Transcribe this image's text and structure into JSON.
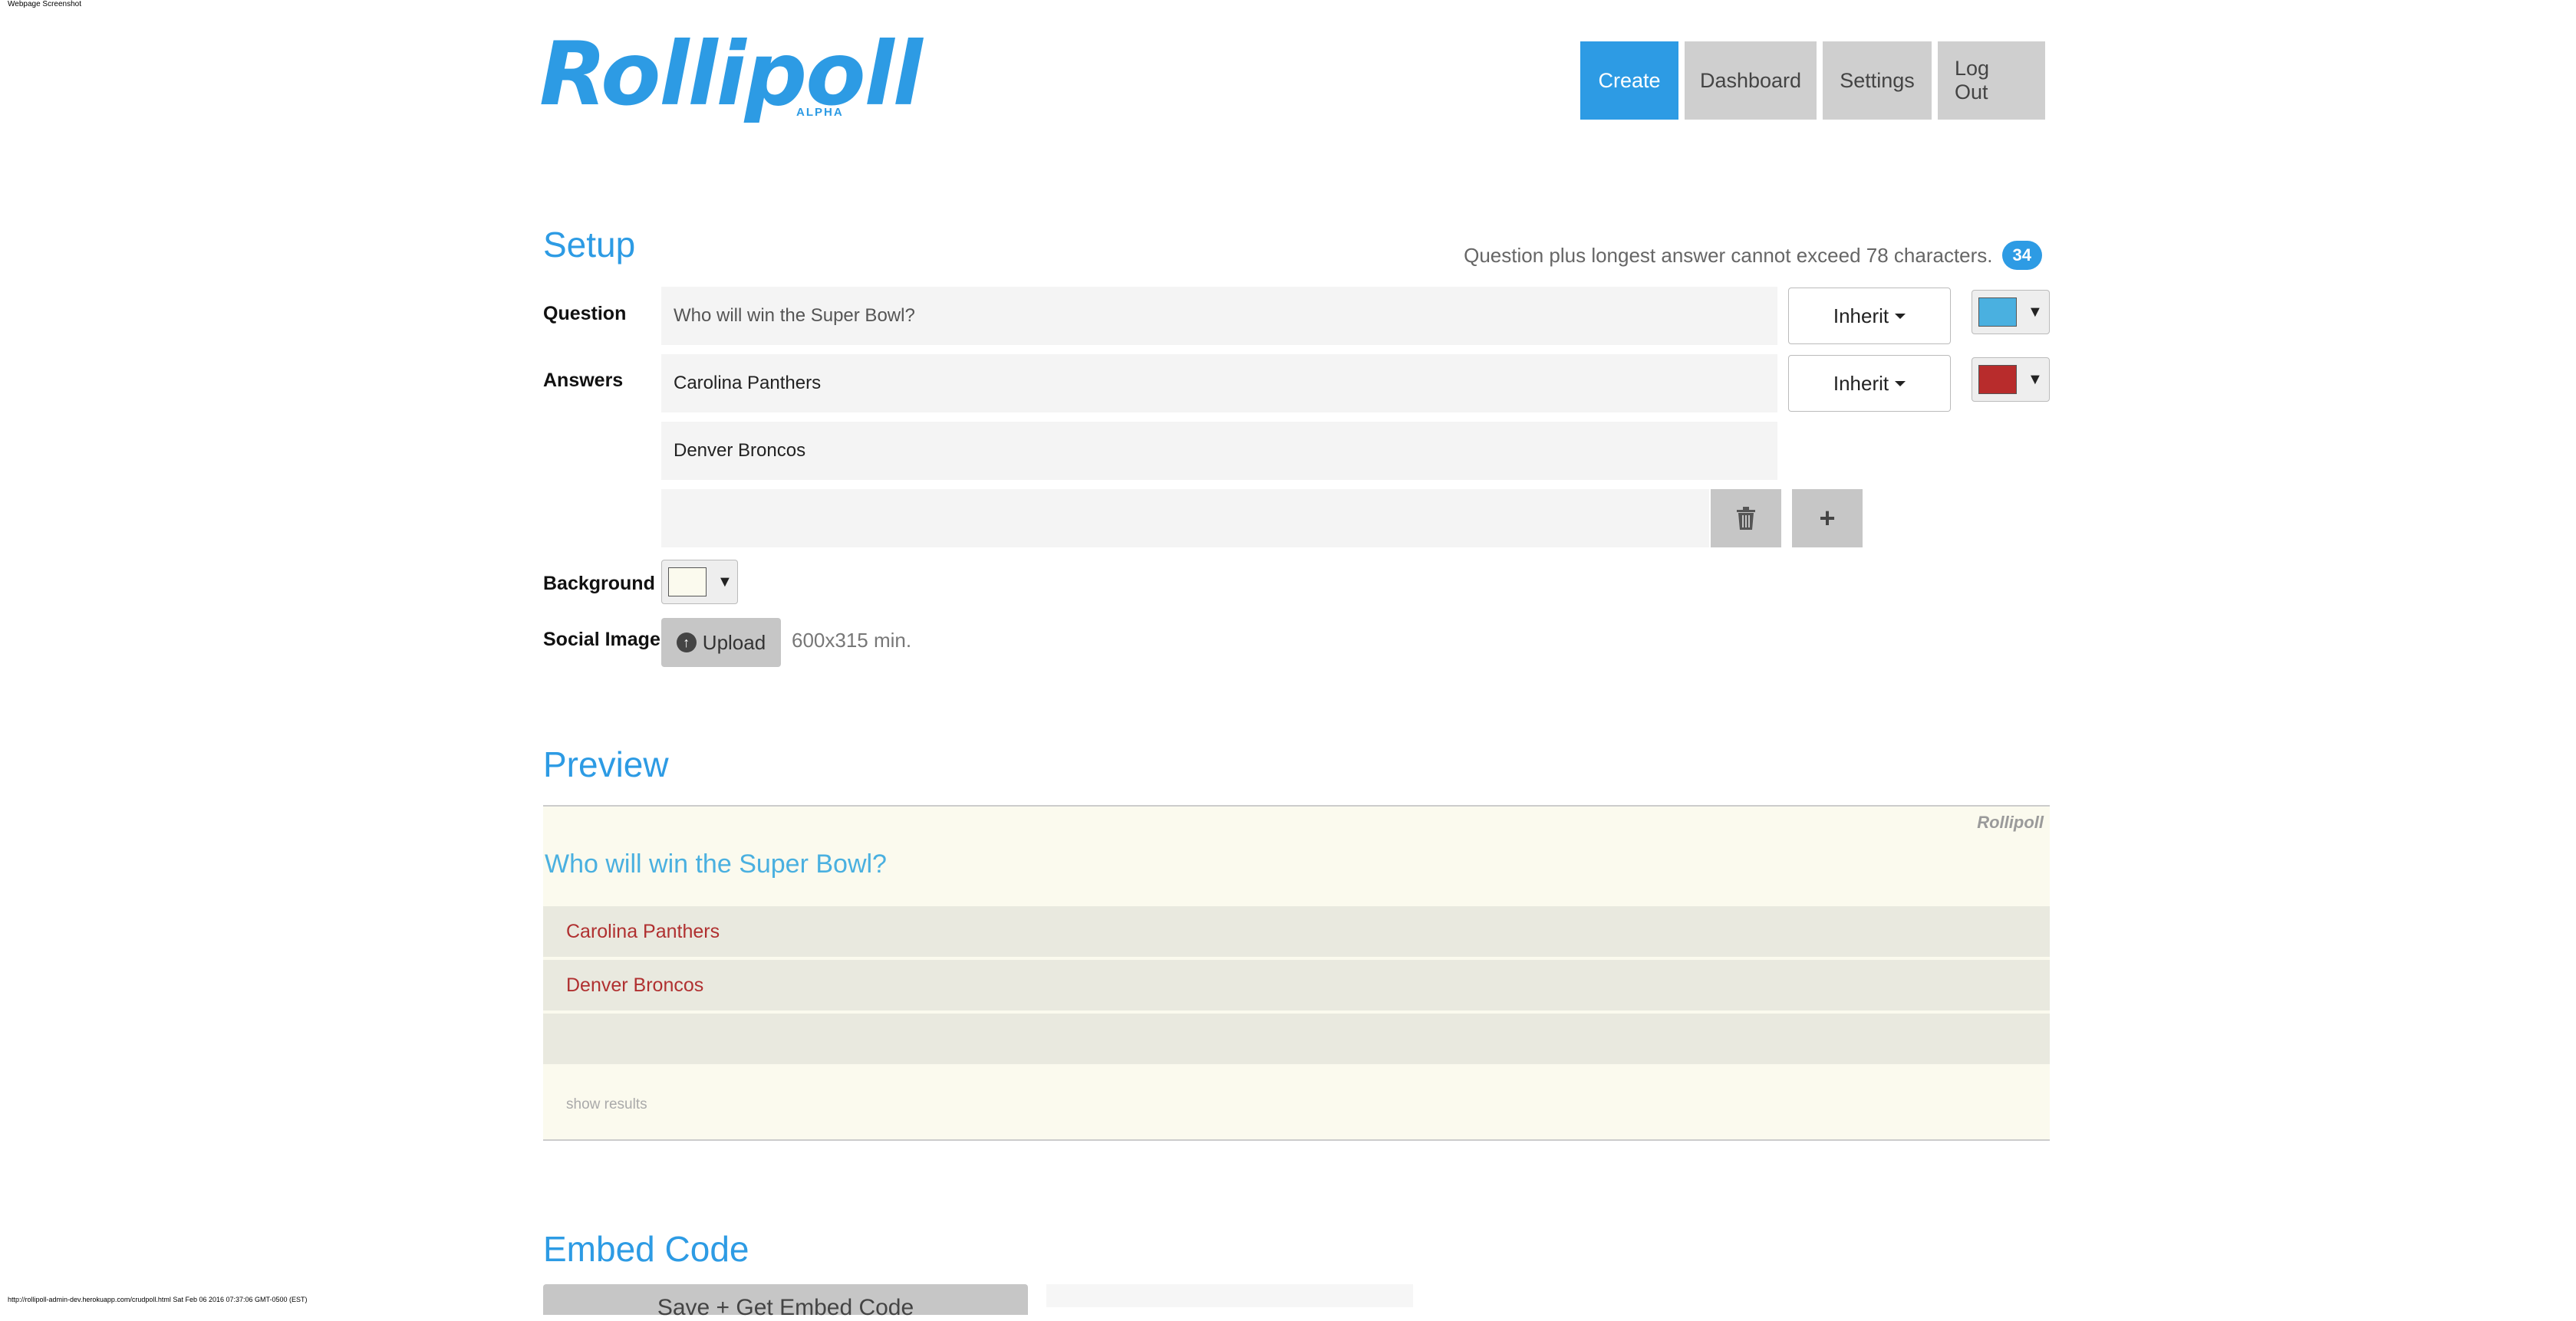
{
  "capture_label": "Webpage Screenshot",
  "footer_url": "http://rollipoll-admin-dev.herokuapp.com/crudpoll.html Sat Feb 06 2016 07:37:06 GMT-0500 (EST)",
  "logo": {
    "name": "Rollipoll",
    "tag": "ALPHA"
  },
  "nav": {
    "create": "Create",
    "dashboard": "Dashboard",
    "settings": "Settings",
    "logout": "Log Out"
  },
  "setup": {
    "title": "Setup",
    "hint": "Question plus longest answer cannot exceed 78 characters.",
    "char_count": "34",
    "question_label": "Question",
    "question_value": "Who will win the Super Bowl?",
    "answers_label": "Answers",
    "answers": [
      "Carolina Panthers",
      "Denver Broncos",
      ""
    ],
    "inherit_label": "Inherit",
    "question_color": "#4ab0e0",
    "answer_color": "#b82c2c",
    "background_label": "Background",
    "background_color": "#fbfaee",
    "social_image_label": "Social Image",
    "upload_label": "Upload",
    "upload_note": "600x315 min."
  },
  "preview": {
    "title": "Preview",
    "brand": "Rollipoll",
    "question": "Who will win the Super Bowl?",
    "answers": [
      "Carolina Panthers",
      "Denver Broncos",
      ""
    ],
    "show_results": "show results"
  },
  "embed": {
    "title": "Embed Code",
    "button_label": "Save + Get Embed Code"
  }
}
